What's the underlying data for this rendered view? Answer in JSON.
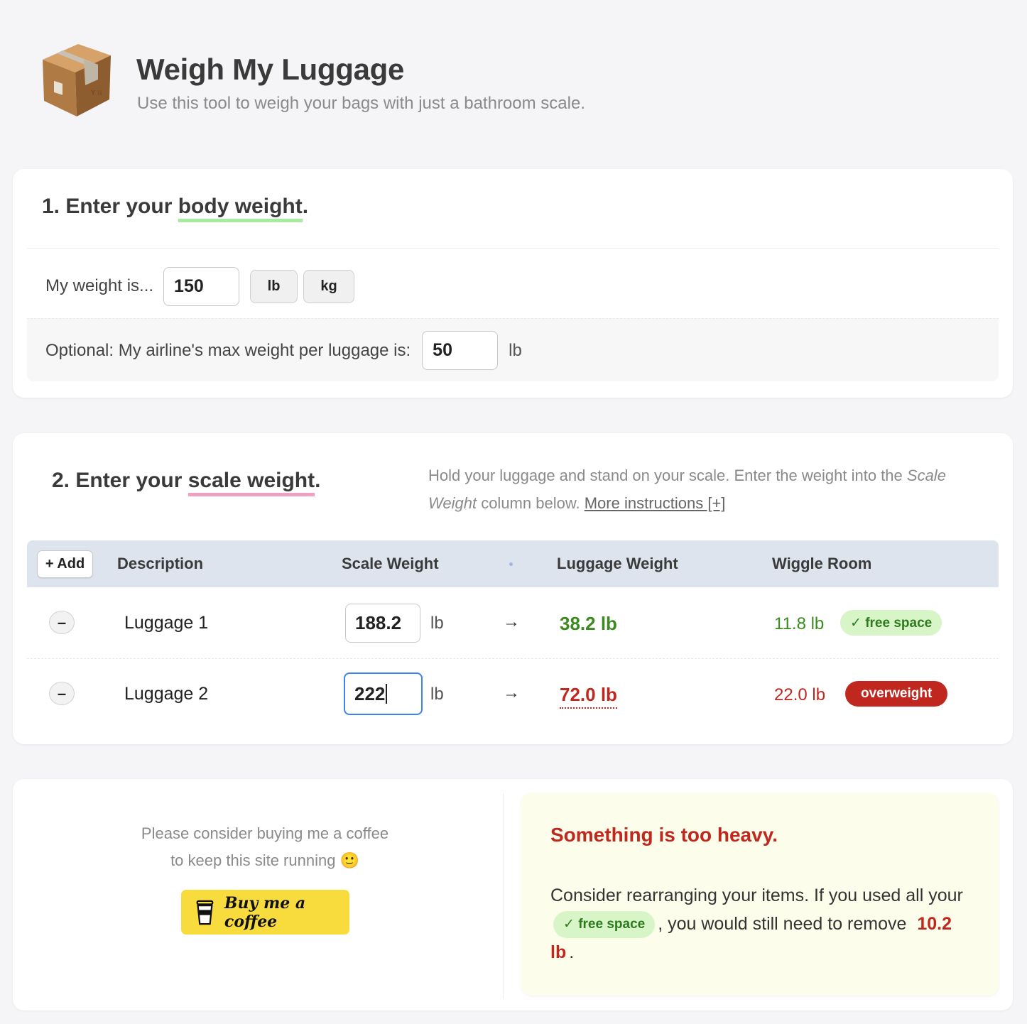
{
  "header": {
    "title": "Weigh My Luggage",
    "subtitle": "Use this tool to weigh your bags with just a bathroom scale."
  },
  "step1": {
    "heading_prefix": "1. Enter your ",
    "heading_highlight": "body weight",
    "heading_suffix": ".",
    "weight_label": "My weight is...",
    "weight_value": "150",
    "unit_lb": "lb",
    "unit_kg": "kg",
    "max_label": "Optional: My airline's max weight per luggage is:",
    "max_value": "50",
    "max_unit": "lb"
  },
  "step2": {
    "heading_prefix": "2. Enter your ",
    "heading_highlight": "scale weight",
    "heading_suffix": ".",
    "instructions_1": "Hold your luggage and stand on your scale. Enter the weight into the ",
    "instructions_em": "Scale Weight",
    "instructions_2": " column below. ",
    "more_link": "More instructions [+]",
    "add_button": "+ Add",
    "columns": {
      "description": "Description",
      "scale_weight": "Scale Weight",
      "luggage_weight": "Luggage Weight",
      "wiggle_room": "Wiggle Room"
    },
    "rows": [
      {
        "remove": "–",
        "description": "Luggage 1",
        "scale_weight": "188.2",
        "unit": "lb",
        "arrow": "→",
        "luggage_weight": "38.2 lb",
        "wiggle_room": "11.8 lb",
        "badge": "✓ free space",
        "status": "ok"
      },
      {
        "remove": "–",
        "description": "Luggage 2",
        "scale_weight": "222",
        "unit": "lb",
        "arrow": "→",
        "luggage_weight": "72.0 lb",
        "wiggle_room": "22.0 lb",
        "badge": "overweight",
        "status": "overweight"
      }
    ]
  },
  "support": {
    "line1": "Please consider buying me a coffee",
    "line2": "to keep this site running 🙂",
    "button": "Buy me a coffee"
  },
  "warning": {
    "title": "Something is too heavy.",
    "body_1": "Consider rearranging your items. If you used all your ",
    "badge": "✓ free space",
    "body_2": ", you would still need to remove ",
    "amount": "10.2 lb",
    "body_3": "."
  },
  "colors": {
    "ok_green": "#3b8b20",
    "over_red": "#c0281f",
    "focus_blue": "#3b82f6",
    "coffee_yellow": "#f8dc3e"
  }
}
